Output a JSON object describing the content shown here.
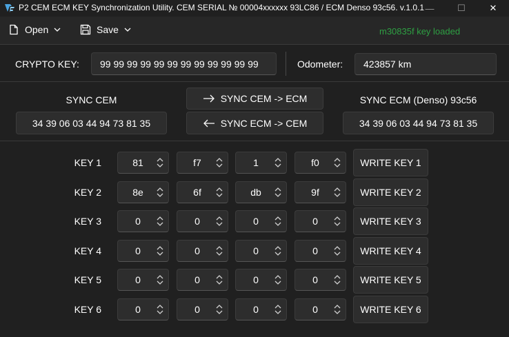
{
  "window": {
    "title": "P2 CEM ECM KEY Synchronization Utility. CEM SERIAL № 00004xxxxxx 93LC86 / ECM Denso 93c56. v.1.0.1",
    "minimize_glyph": "—",
    "maximize_glyph": "☐",
    "close_glyph": "✕"
  },
  "toolbar": {
    "open_label": "Open",
    "save_label": "Save",
    "status_text": "m30835f key loaded",
    "status_color": "#2ea043"
  },
  "crypto": {
    "label": "CRYPTO KEY:",
    "value": "99 99 99 99 99 99 99 99 99 99 99 99",
    "odometer_label": "Odometer:",
    "odometer_value": "423857 km"
  },
  "sync": {
    "cem_title": "SYNC CEM",
    "cem_value": "34 39 06 03 44 94 73 81 35",
    "ecm_title": "SYNC ECM (Denso) 93c56",
    "ecm_value": "34 39 06 03 44 94 73 81 35",
    "to_ecm_label": "SYNC CEM -> ECM",
    "to_cem_label": "SYNC ECM -> CEM"
  },
  "keys": [
    {
      "label": "KEY 1",
      "bytes": [
        "81",
        "f7",
        "1",
        "f0"
      ],
      "write_label": "WRITE KEY 1"
    },
    {
      "label": "KEY 2",
      "bytes": [
        "8e",
        "6f",
        "db",
        "9f"
      ],
      "write_label": "WRITE KEY 2"
    },
    {
      "label": "KEY 3",
      "bytes": [
        "0",
        "0",
        "0",
        "0"
      ],
      "write_label": "WRITE KEY 3"
    },
    {
      "label": "KEY 4",
      "bytes": [
        "0",
        "0",
        "0",
        "0"
      ],
      "write_label": "WRITE KEY 4"
    },
    {
      "label": "KEY 5",
      "bytes": [
        "0",
        "0",
        "0",
        "0"
      ],
      "write_label": "WRITE KEY 5"
    },
    {
      "label": "KEY 6",
      "bytes": [
        "0",
        "0",
        "0",
        "0"
      ],
      "write_label": "WRITE KEY 6"
    }
  ],
  "colors": {
    "background": "#202020",
    "control": "#2d2d2d",
    "accent_logo": "#4aa3df"
  }
}
